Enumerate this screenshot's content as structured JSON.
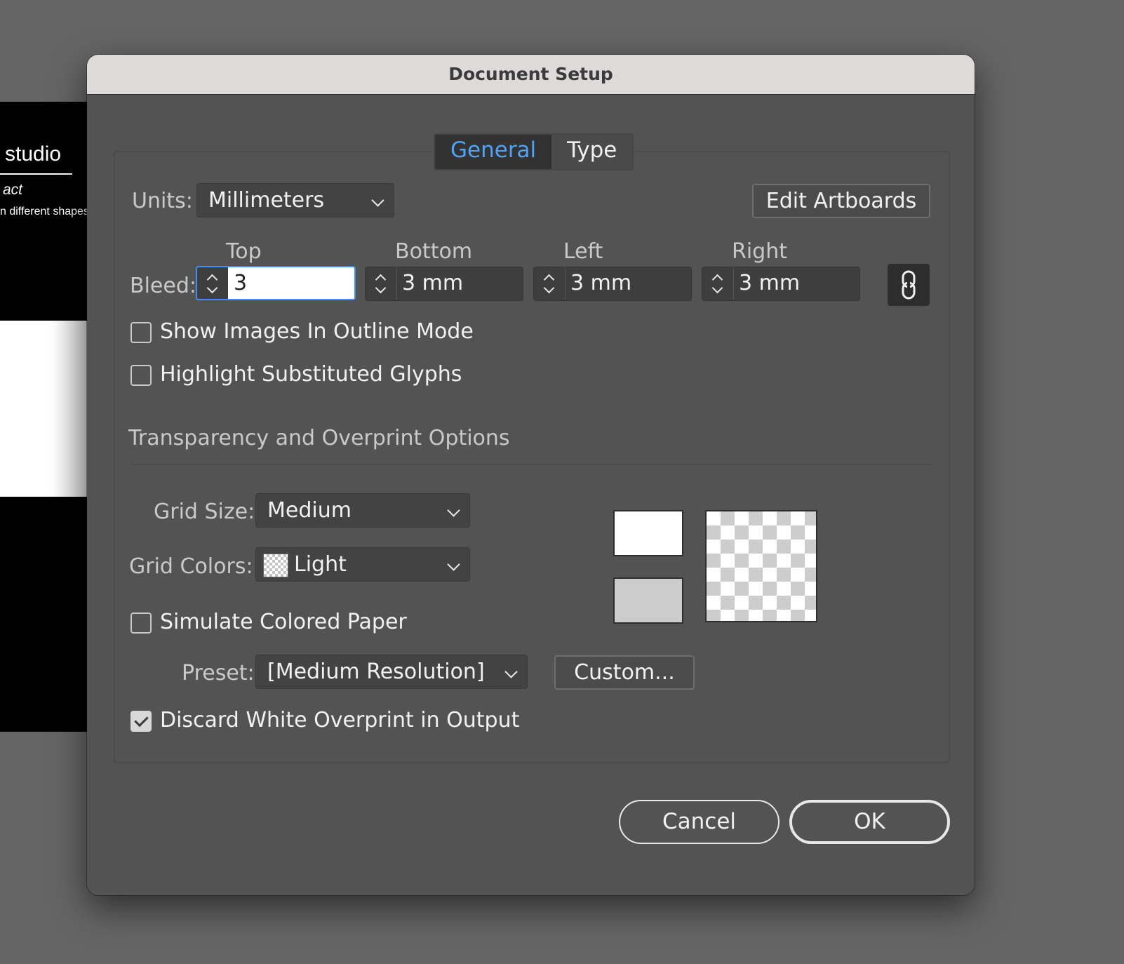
{
  "background_doc": {
    "studio_text": "studio",
    "act_text": "act",
    "shapes_text": "n different shapes"
  },
  "dialog": {
    "title": "Document Setup",
    "tabs": [
      {
        "label": "General",
        "active": true
      },
      {
        "label": "Type",
        "active": false
      }
    ],
    "units": {
      "label": "Units:",
      "value": "Millimeters"
    },
    "edit_artboards_label": "Edit Artboards",
    "bleed": {
      "label": "Bleed:",
      "top": {
        "label": "Top",
        "value": "3"
      },
      "bottom": {
        "label": "Bottom",
        "value": "3 mm"
      },
      "left": {
        "label": "Left",
        "value": "3 mm"
      },
      "right": {
        "label": "Right",
        "value": "3 mm"
      },
      "link_icon": "chain-link-icon"
    },
    "options": {
      "show_images_outline": {
        "label": "Show Images In Outline Mode",
        "checked": false
      },
      "highlight_glyphs": {
        "label": "Highlight Substituted Glyphs",
        "checked": false
      }
    },
    "transparency": {
      "heading": "Transparency and Overprint Options",
      "grid_size": {
        "label": "Grid Size:",
        "value": "Medium"
      },
      "grid_colors": {
        "label": "Grid Colors:",
        "value": "Light"
      },
      "simulate_paper": {
        "label": "Simulate Colored Paper",
        "checked": false
      },
      "preset": {
        "label": "Preset:",
        "value": "[Medium Resolution]"
      },
      "custom_label": "Custom...",
      "discard_white": {
        "label": "Discard White Overprint in Output",
        "checked": true
      }
    },
    "buttons": {
      "cancel": "Cancel",
      "ok": "OK"
    },
    "colors": {
      "accent": "#4fa3f7",
      "focus": "#3f8ef0",
      "dialog_bg": "#535353"
    }
  }
}
